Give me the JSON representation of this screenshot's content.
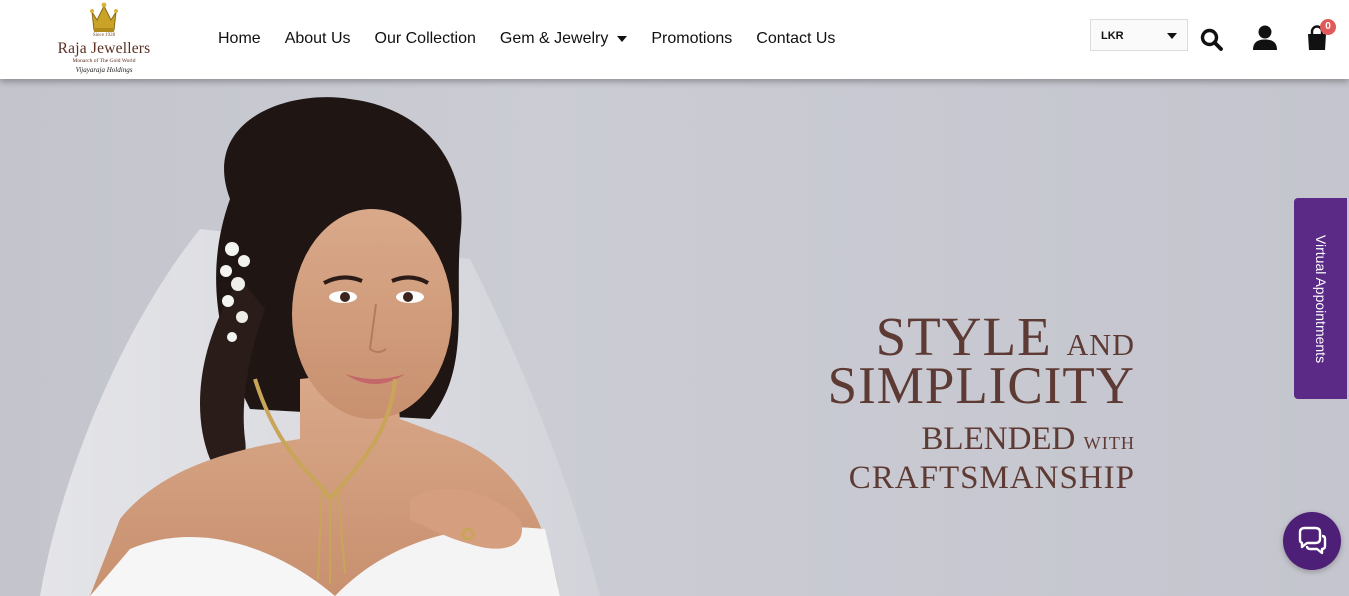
{
  "header": {
    "logo": {
      "since": "Since 1928",
      "name": "Raja Jewellers",
      "tagline": "Monarch of The Gold World",
      "holding": "Vijayaraja Holdings"
    },
    "nav": [
      {
        "label": "Home"
      },
      {
        "label": "About Us"
      },
      {
        "label": "Our Collection"
      },
      {
        "label": "Gem & Jewelry",
        "has_dropdown": true
      },
      {
        "label": "Promotions"
      },
      {
        "label": "Contact Us"
      }
    ],
    "currency": {
      "selected": "LKR"
    },
    "icons": [
      "search-icon",
      "user-icon",
      "cart-icon"
    ],
    "cart_count": "0"
  },
  "hero": {
    "line1": "STYLE",
    "line1_small": "AND",
    "line2": "SIMPLICITY",
    "line3": "BLENDED",
    "line3_small": "WITH",
    "line4": "CRAFTSMANSHIP",
    "text_color": "#5e3a34"
  },
  "side_tab": {
    "label": "Virtual Appointments",
    "color": "#5a2a86"
  },
  "chat": {
    "icon": "chat-icon",
    "color": "#4d1f77"
  }
}
